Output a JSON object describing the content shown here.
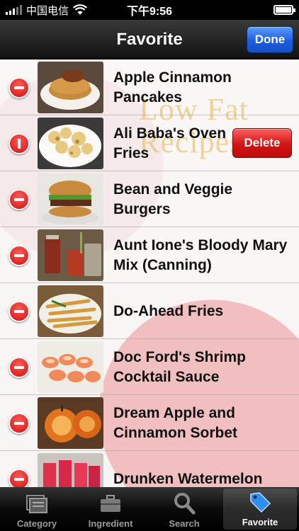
{
  "status_bar": {
    "carrier": "中国电信",
    "time": "下午9:56",
    "battery_percent": 100
  },
  "nav": {
    "title": "Favorite",
    "done_label": "Done"
  },
  "watermark": {
    "line1": "Low Fat",
    "line2": "Recipes"
  },
  "rows": [
    {
      "title": "Apple Cinnamon Pancakes"
    },
    {
      "title": "Ali Baba's Oven Fries",
      "delete_label": "Delete"
    },
    {
      "title": "Bean and Veggie Burgers"
    },
    {
      "title": "Aunt Ione's Bloody Mary Mix (Canning)"
    },
    {
      "title": "Do-Ahead Fries"
    },
    {
      "title": "Doc Ford's Shrimp Cocktail Sauce"
    },
    {
      "title": "Dream Apple and Cinnamon Sorbet"
    },
    {
      "title": "Drunken Watermelon"
    }
  ],
  "tabs": [
    {
      "label": "Category",
      "icon": "category-icon"
    },
    {
      "label": "Ingredient",
      "icon": "briefcase-icon"
    },
    {
      "label": "Search",
      "icon": "magnifier-icon"
    },
    {
      "label": "Favorite",
      "icon": "tag-icon",
      "active": true
    }
  ],
  "colors": {
    "delete_red": "#d11414",
    "done_blue": "#1d5ee0"
  }
}
